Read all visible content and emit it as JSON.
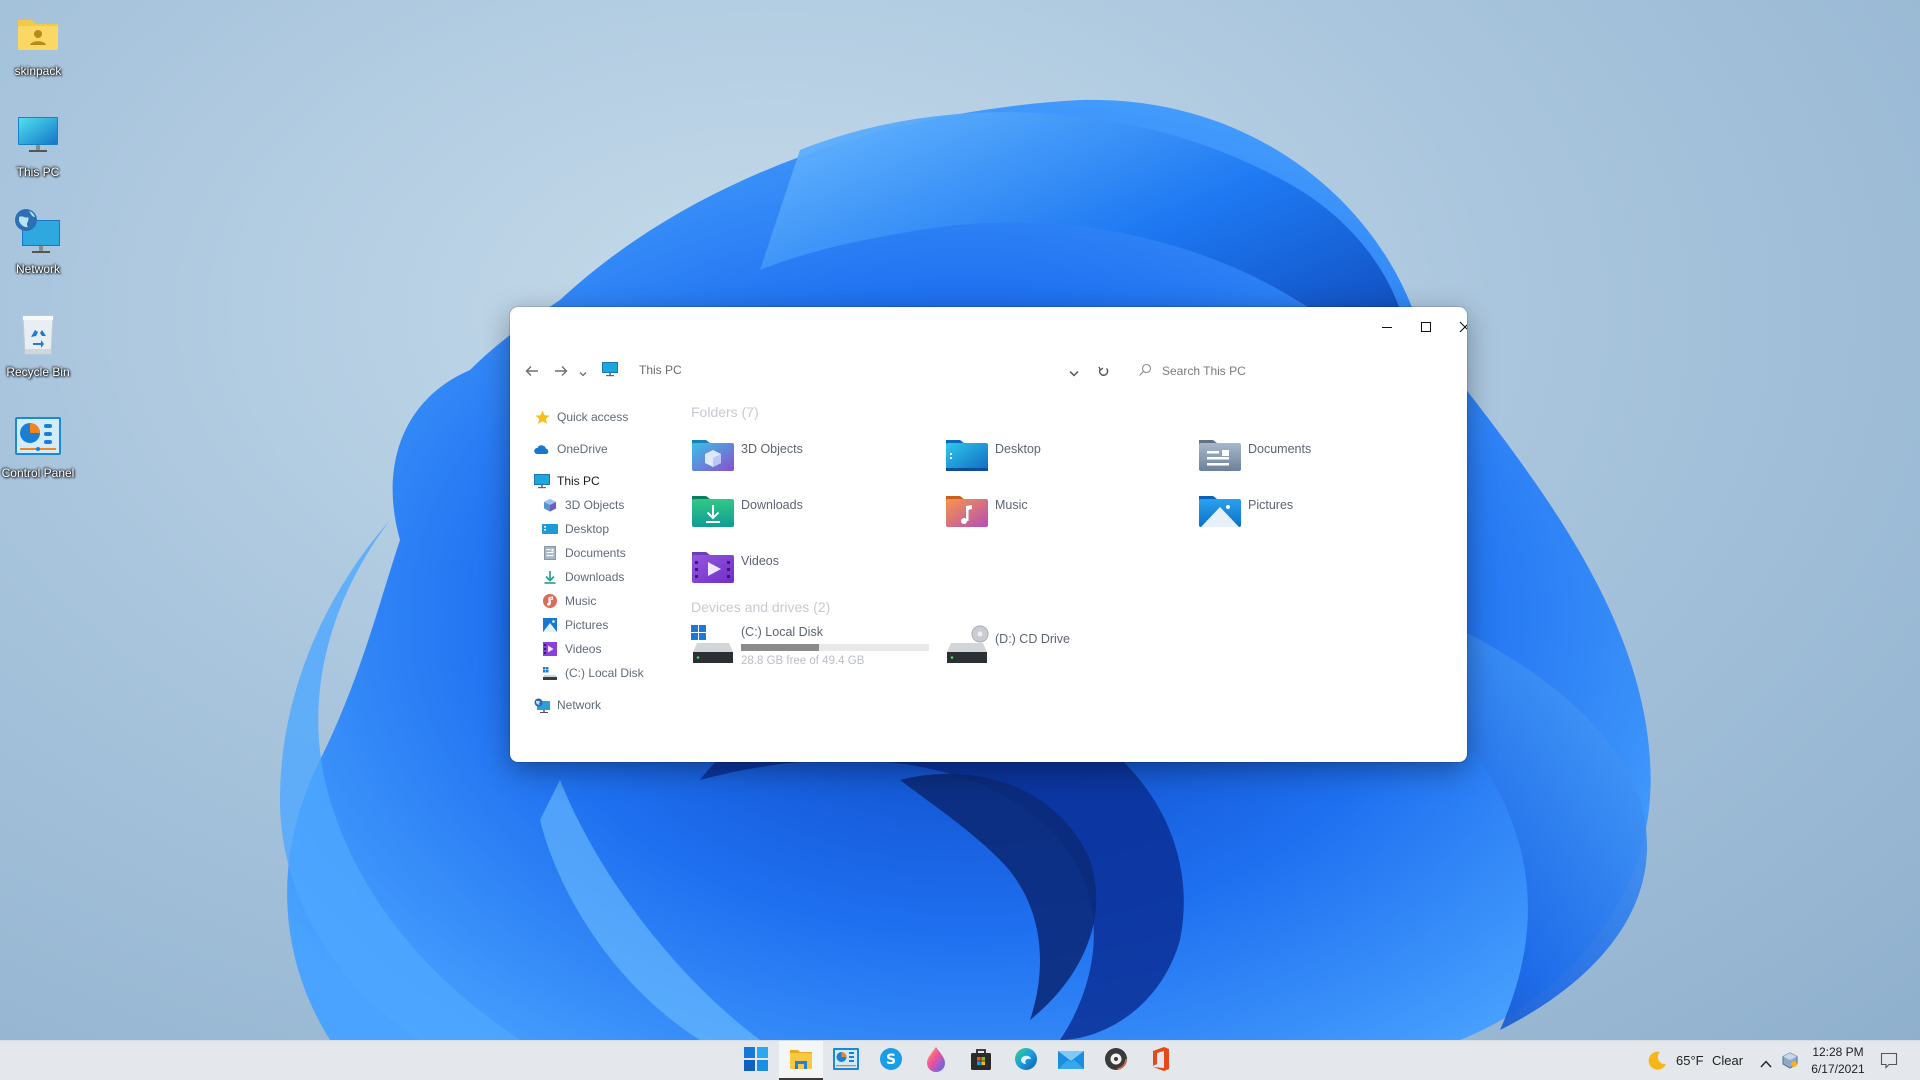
{
  "desktop": {
    "icons": [
      {
        "label": "skinpack",
        "icon": "user-folder-icon"
      },
      {
        "label": "This PC",
        "icon": "monitor-icon"
      },
      {
        "label": "Network",
        "icon": "network-icon"
      },
      {
        "label": "Recycle Bin",
        "icon": "recycle-bin-icon"
      },
      {
        "label": "Control Panel",
        "icon": "control-panel-icon"
      }
    ]
  },
  "explorer": {
    "caption": {
      "minimize": "minimize-icon",
      "maximize": "maximize-icon",
      "close": "close-icon"
    },
    "address": {
      "location_icon": "this-pc-icon",
      "path": "This PC"
    },
    "search": {
      "placeholder": "Search This PC",
      "value": ""
    },
    "navpane": {
      "items": [
        {
          "label": "Quick access",
          "icon": "star-icon",
          "level": 0
        },
        {
          "label": "OneDrive",
          "icon": "cloud-icon",
          "level": 0
        },
        {
          "label": "This PC",
          "icon": "monitor-icon",
          "level": 0,
          "selected": true
        },
        {
          "label": "3D Objects",
          "icon": "cube-icon",
          "level": 1
        },
        {
          "label": "Desktop",
          "icon": "desktop-icon",
          "level": 1
        },
        {
          "label": "Documents",
          "icon": "document-icon",
          "level": 1
        },
        {
          "label": "Downloads",
          "icon": "download-icon",
          "level": 1
        },
        {
          "label": "Music",
          "icon": "music-icon",
          "level": 1
        },
        {
          "label": "Pictures",
          "icon": "picture-icon",
          "level": 1
        },
        {
          "label": "Videos",
          "icon": "video-icon",
          "level": 1
        },
        {
          "label": "(C:) Local Disk",
          "icon": "drive-icon",
          "level": 1
        },
        {
          "label": "Network",
          "icon": "network-icon",
          "level": 0
        }
      ]
    },
    "folders_section": {
      "title": "Folders (7)"
    },
    "folders": [
      {
        "label": "3D Objects",
        "icon": "3d-objects-folder-icon"
      },
      {
        "label": "Desktop",
        "icon": "desktop-folder-icon"
      },
      {
        "label": "Documents",
        "icon": "documents-folder-icon"
      },
      {
        "label": "Downloads",
        "icon": "downloads-folder-icon"
      },
      {
        "label": "Music",
        "icon": "music-folder-icon"
      },
      {
        "label": "Pictures",
        "icon": "pictures-folder-icon"
      },
      {
        "label": "Videos",
        "icon": "videos-folder-icon"
      }
    ],
    "drives_section": {
      "title": "Devices and drives (2)"
    },
    "drives": [
      {
        "label": "(C:) Local Disk",
        "icon": "windows-drive-icon",
        "free_text": "28.8 GB free of 49.4 GB",
        "used_fraction": 0.417
      },
      {
        "label": "(D:) CD Drive",
        "icon": "cd-drive-icon"
      }
    ]
  },
  "taskbar": {
    "apps": [
      {
        "name": "Start",
        "icon": "windows-start-icon"
      },
      {
        "name": "File Explorer",
        "icon": "file-explorer-icon",
        "active": true
      },
      {
        "name": "Control Panel",
        "icon": "control-panel-icon"
      },
      {
        "name": "Skype",
        "icon": "skype-icon"
      },
      {
        "name": "Paint",
        "icon": "paint-drop-icon"
      },
      {
        "name": "Microsoft Store",
        "icon": "store-bag-icon"
      },
      {
        "name": "Microsoft Edge",
        "icon": "edge-icon"
      },
      {
        "name": "Mail",
        "icon": "mail-icon"
      },
      {
        "name": "Groove Music",
        "icon": "music-disc-icon"
      },
      {
        "name": "Office",
        "icon": "office-icon"
      }
    ],
    "tray": {
      "weather_icon": "moon-icon",
      "temperature": "65°F",
      "condition": "Clear",
      "time": "12:28 PM",
      "date": "6/17/2021"
    }
  },
  "colors": {
    "accent": "#0078d4",
    "taskbar": "#e4e8ec",
    "drive_bar_fill": "#8b8b8b"
  }
}
